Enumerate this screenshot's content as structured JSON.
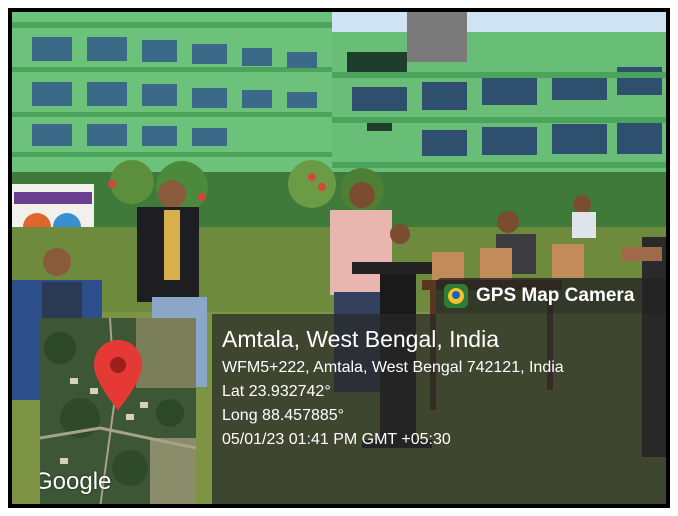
{
  "photo": {
    "building_signs": {
      "main_sign": "",
      "entrance_sign": ""
    }
  },
  "overlay": {
    "app_name": "GPS Map Camera",
    "app_icon": "gps-map-camera-icon",
    "map_pin_icon": "map-pin-icon",
    "map_pin_color": "#e53935",
    "map_attribution": "Google",
    "place_title": "Amtala, West Bengal, India",
    "address": "WFM5+222, Amtala, West Bengal 742121, India",
    "latitude": "Lat 23.932742°",
    "longitude": "Long 88.457885°",
    "datetime": "05/01/23 01:41 PM GMT +05:30"
  }
}
